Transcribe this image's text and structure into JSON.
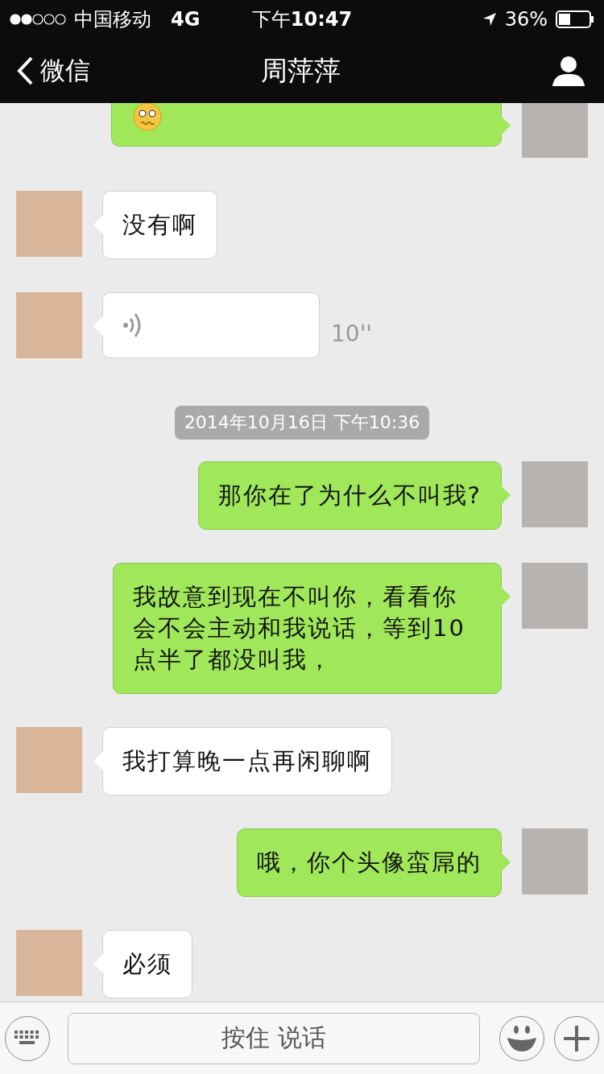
{
  "status_bar": {
    "carrier": "中国移动",
    "network": "4G",
    "time": "下午**10:47**",
    "battery": "36%"
  },
  "nav": {
    "back": "微信",
    "title": "周萍萍"
  },
  "messages": [
    {
      "kind": "emoji",
      "outgoing": true
    },
    {
      "kind": "text",
      "outgoing": false,
      "text": "没有啊"
    },
    {
      "kind": "voice",
      "outgoing": false,
      "duration": "10''"
    },
    {
      "kind": "time",
      "text": "2014年10月16日  下午10:36"
    },
    {
      "kind": "text",
      "outgoing": true,
      "text": "那你在了为什么不叫我?"
    },
    {
      "kind": "text",
      "outgoing": true,
      "text": "我故意到现在不叫你，看看你会不会主动和我说话，等到10点半了都没叫我，"
    },
    {
      "kind": "text",
      "outgoing": false,
      "text": "我打算晚一点再闲聊啊"
    },
    {
      "kind": "text",
      "outgoing": true,
      "text": "哦，你个头像蛮屌的"
    },
    {
      "kind": "text",
      "outgoing": false,
      "text": "必须"
    }
  ],
  "input_bar": {
    "hold_button": "按住 说话"
  }
}
